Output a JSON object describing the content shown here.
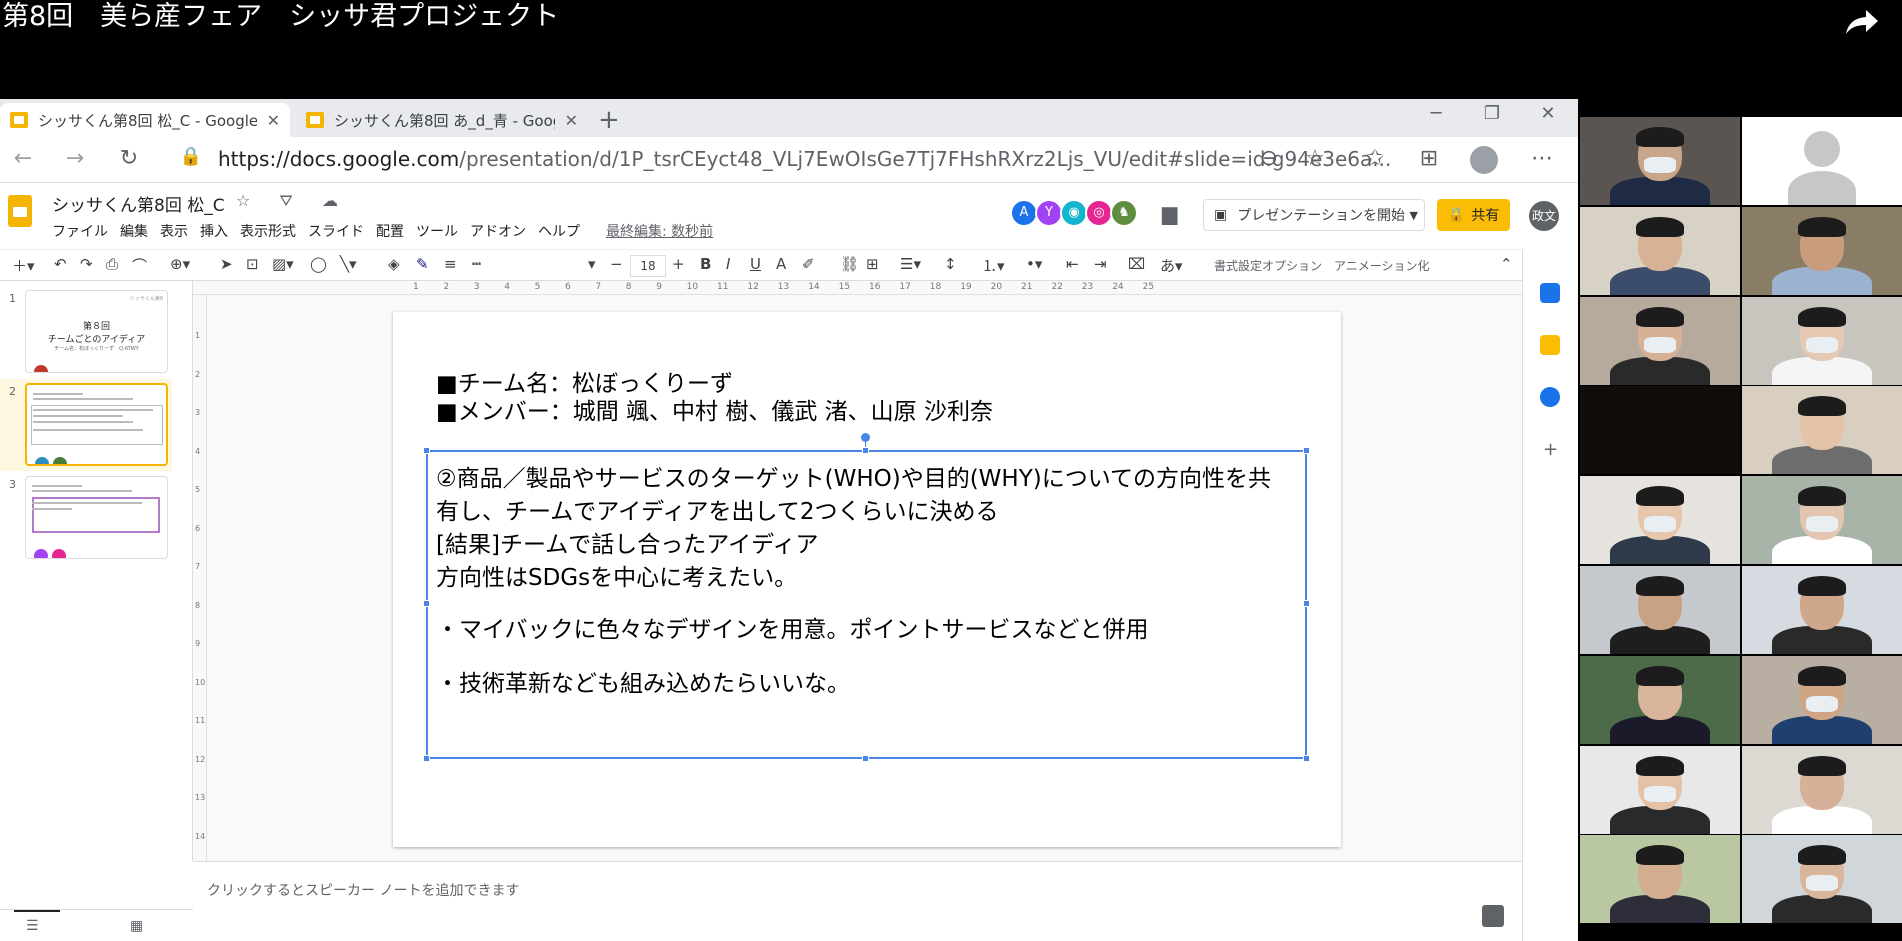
{
  "video": {
    "title": "第8回　美ら産フェア　シッサ君プロジェクト",
    "share_icon": "share-arrow-icon"
  },
  "browser": {
    "tabs": [
      {
        "label": "シッサくん第8回 松_C - Google ス",
        "active": true
      },
      {
        "label": "シッサくん第8回 あ_d_青 - Google",
        "active": false
      }
    ],
    "new_tab": "+",
    "window_controls": {
      "minimize": "─",
      "restore": "❐",
      "close": "✕"
    },
    "url_host": "https://docs.google.com",
    "url_path": "/presentation/d/1P_tsrCEyct48_VLj7EwOIsGe7Tj7FHshRXrz2Ljs_VU/edit#slide=id.g94e3e6a...",
    "icons": {
      "back": "←",
      "forward": "→",
      "reload": "↻",
      "lock": "🔒",
      "zoom": "⊖",
      "star": "☆",
      "favorites": "✩",
      "collections": "⊞",
      "more": "⋯"
    }
  },
  "app": {
    "doc_title": "シッサくん第8回 松_C",
    "title_icons": "☆ ⛛ ☁",
    "menu": [
      "ファイル",
      "編集",
      "表示",
      "挿入",
      "表示形式",
      "スライド",
      "配置",
      "ツール",
      "アドオン",
      "ヘルプ"
    ],
    "last_edit": "最終編集: 数秒前",
    "collaborators": [
      {
        "initial": "A",
        "color": "#1a73e8"
      },
      {
        "initial": "Y",
        "color": "#a142f4"
      },
      {
        "initial": "◉",
        "color": "#12b5cb"
      },
      {
        "initial": "◎",
        "color": "#e52592"
      },
      {
        "initial": "♞",
        "color": "#5f8f3e"
      }
    ],
    "present_label": "プレゼンテーションを開始",
    "share_label": "共有",
    "user_initials": "政文",
    "colors": {
      "accent": "#f4b400",
      "selection": "#4a86e8",
      "share": "#fbbc04"
    }
  },
  "toolbar": {
    "font_size": "18",
    "format_options": "書式設定オプション",
    "animation": "アニメーション化"
  },
  "filmstrip": {
    "slides": [
      {
        "number": "1",
        "title": "第８回",
        "subtitle": "チームごとのアイディア",
        "note": "チーム名：松ぼっくりーず　Q.ATWY",
        "corner": "シッサくん第8"
      },
      {
        "number": "2",
        "selected": true
      },
      {
        "number": "3"
      }
    ]
  },
  "slide": {
    "team_line": "■チーム名：松ぼっくりーず",
    "member_line": "■メンバー：城間 颯、中村 樹、儀武 渚、山原 沙利奈",
    "body": [
      "②商品／製品やサービスのターゲット(WHO)や目的(WHY)についての方向性を共",
      "有し、チームでアイディアを出して2つくらいに決める",
      "[結果]チームで話し合ったアイディア",
      "方向性はSDGsを中心に考えたい。",
      "・マイバックに色々なデザインを用意。ポイントサービスなどと併用",
      "・技術革新なども組み込めたらいいな。"
    ]
  },
  "ruler": {
    "ticks": [
      "1",
      "2",
      "3",
      "4",
      "5",
      "6",
      "7",
      "8",
      "9",
      "10",
      "11",
      "12",
      "13",
      "14",
      "15",
      "16",
      "17",
      "18",
      "19",
      "20",
      "21",
      "22",
      "23",
      "24",
      "25"
    ],
    "vticks": [
      "1",
      "2",
      "3",
      "4",
      "5",
      "6",
      "7",
      "8",
      "9",
      "10",
      "11",
      "12",
      "13",
      "14"
    ]
  },
  "notes": {
    "placeholder": "クリックするとスピーカー ノートを追加できます"
  },
  "participants": [
    {
      "type": "person",
      "bg": "#5a5550",
      "skin": "#c9a58a",
      "clothes": "#1f2a44",
      "mask": true
    },
    {
      "type": "default",
      "bg": "#ffffff"
    },
    {
      "type": "person",
      "bg": "#d8d2c6",
      "skin": "#d8b295",
      "clothes": "#3c4d6b",
      "mask": false
    },
    {
      "type": "person",
      "bg": "#8a7d66",
      "skin": "#c89c7c",
      "clothes": "#9bb3cf",
      "mask": false
    },
    {
      "type": "person",
      "bg": "#b6aa9d",
      "skin": "#d6b196",
      "clothes": "#2a2a2a",
      "mask": true
    },
    {
      "type": "person",
      "bg": "#c8c4be",
      "skin": "#e5c9b3",
      "clothes": "#f5f5f5",
      "mask": true
    },
    {
      "type": "dark",
      "bg": "#120d0b"
    },
    {
      "type": "person",
      "bg": "#d9cfc0",
      "skin": "#e4c4a8",
      "clothes": "#6d6d6d",
      "mask": false
    },
    {
      "type": "person",
      "bg": "#e6e3df",
      "skin": "#e6c6ad",
      "clothes": "#2e3a4a",
      "mask": true
    },
    {
      "type": "person",
      "bg": "#a8b4a8",
      "skin": "#e3c5b0",
      "clothes": "#ffffff",
      "mask": true
    },
    {
      "type": "person",
      "bg": "#c5c8cc",
      "skin": "#c9a283",
      "clothes": "#1e1e1e",
      "mask": false
    },
    {
      "type": "person",
      "bg": "#d5dbe0",
      "skin": "#cfa88c",
      "clothes": "#2a2a2a",
      "mask": false
    },
    {
      "type": "person",
      "bg": "#4d6b48",
      "skin": "#d8b49a",
      "clothes": "#1a1a2a",
      "mask": false
    },
    {
      "type": "person",
      "bg": "#b8aea2",
      "skin": "#cfa586",
      "clothes": "#1f3f6f",
      "mask": true
    },
    {
      "type": "person",
      "bg": "#e8e8e8",
      "skin": "#e4c2a8",
      "clothes": "#2a2a2a",
      "mask": true
    },
    {
      "type": "person",
      "bg": "#dcd8d2",
      "skin": "#d6b098",
      "clothes": "#ffffff",
      "mask": false
    },
    {
      "type": "person",
      "bg": "#b9c8a2",
      "skin": "#d5ad90",
      "clothes": "#2e2e3a",
      "mask": false
    },
    {
      "type": "person",
      "bg": "#d0d6da",
      "skin": "#d9b59b",
      "clothes": "#2a2a2a",
      "mask": true
    }
  ]
}
